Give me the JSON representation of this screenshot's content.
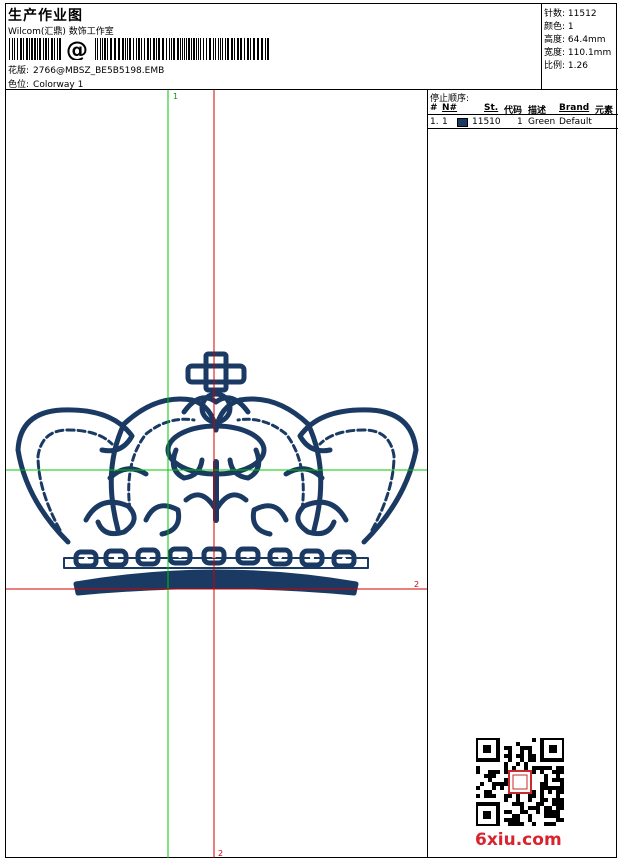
{
  "header": {
    "title": "生产作业图",
    "company": "Wilcom(汇鼎) 数饰工作室",
    "barcode_char": "@",
    "design_label": "花版:",
    "design_value": "2766@MBSZ_BE5B5198.EMB",
    "color_label": "色位:",
    "color_value": "Colorway 1"
  },
  "stats": {
    "stitches_label": "针数:",
    "stitches_value": "11512",
    "colors_label": "颜色:",
    "colors_value": "1",
    "height_label": "高度:",
    "height_value": "64.4mm",
    "width_label": "宽度:",
    "width_value": "110.1mm",
    "ratio_label": "比例:",
    "ratio_value": "1.26"
  },
  "stop_sequence": {
    "title": "停止顺序:",
    "columns": [
      "#",
      "N#",
      "St.",
      "代码",
      "描述",
      "Brand",
      "元素"
    ],
    "rows": [
      {
        "num": "1.",
        "n": "1",
        "st": "11510",
        "code": "1",
        "desc": "Green",
        "brand": "Default",
        "swatch": "#1a3a63"
      }
    ]
  },
  "canvas": {
    "marker_top": "1",
    "marker_right": "2",
    "marker_bottom": "2",
    "thread_color": "#1a3a63",
    "green_guide": "#00c800",
    "red_guide": "#d00000"
  },
  "watermark": {
    "text": "6xiu.com",
    "color": "#d9232e"
  }
}
